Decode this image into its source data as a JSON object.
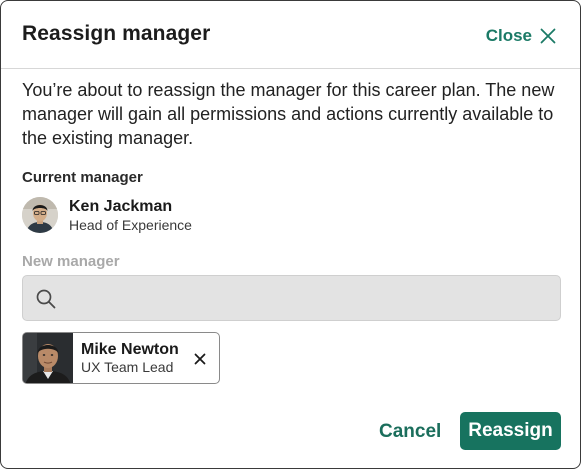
{
  "dialog": {
    "title": "Reassign manager",
    "close_label": "Close",
    "description": "You’re about to reassign the manager for this career plan. The new manager will gain all permissions and actions currently available to the existing manager."
  },
  "current_manager": {
    "section_label": "Current manager",
    "name": "Ken Jackman",
    "role": "Head of Experience"
  },
  "new_manager": {
    "section_label": "New manager",
    "search_value": "",
    "selected": {
      "name": "Mike Newton",
      "role": "UX Team Lead"
    }
  },
  "footer": {
    "cancel_label": "Cancel",
    "reassign_label": "Reassign"
  },
  "colors": {
    "accent": "#17735f",
    "accent_text": "#1b7a66",
    "search_bg": "#e3e3e3"
  },
  "icons": [
    "close-icon",
    "search-icon",
    "remove-icon"
  ]
}
